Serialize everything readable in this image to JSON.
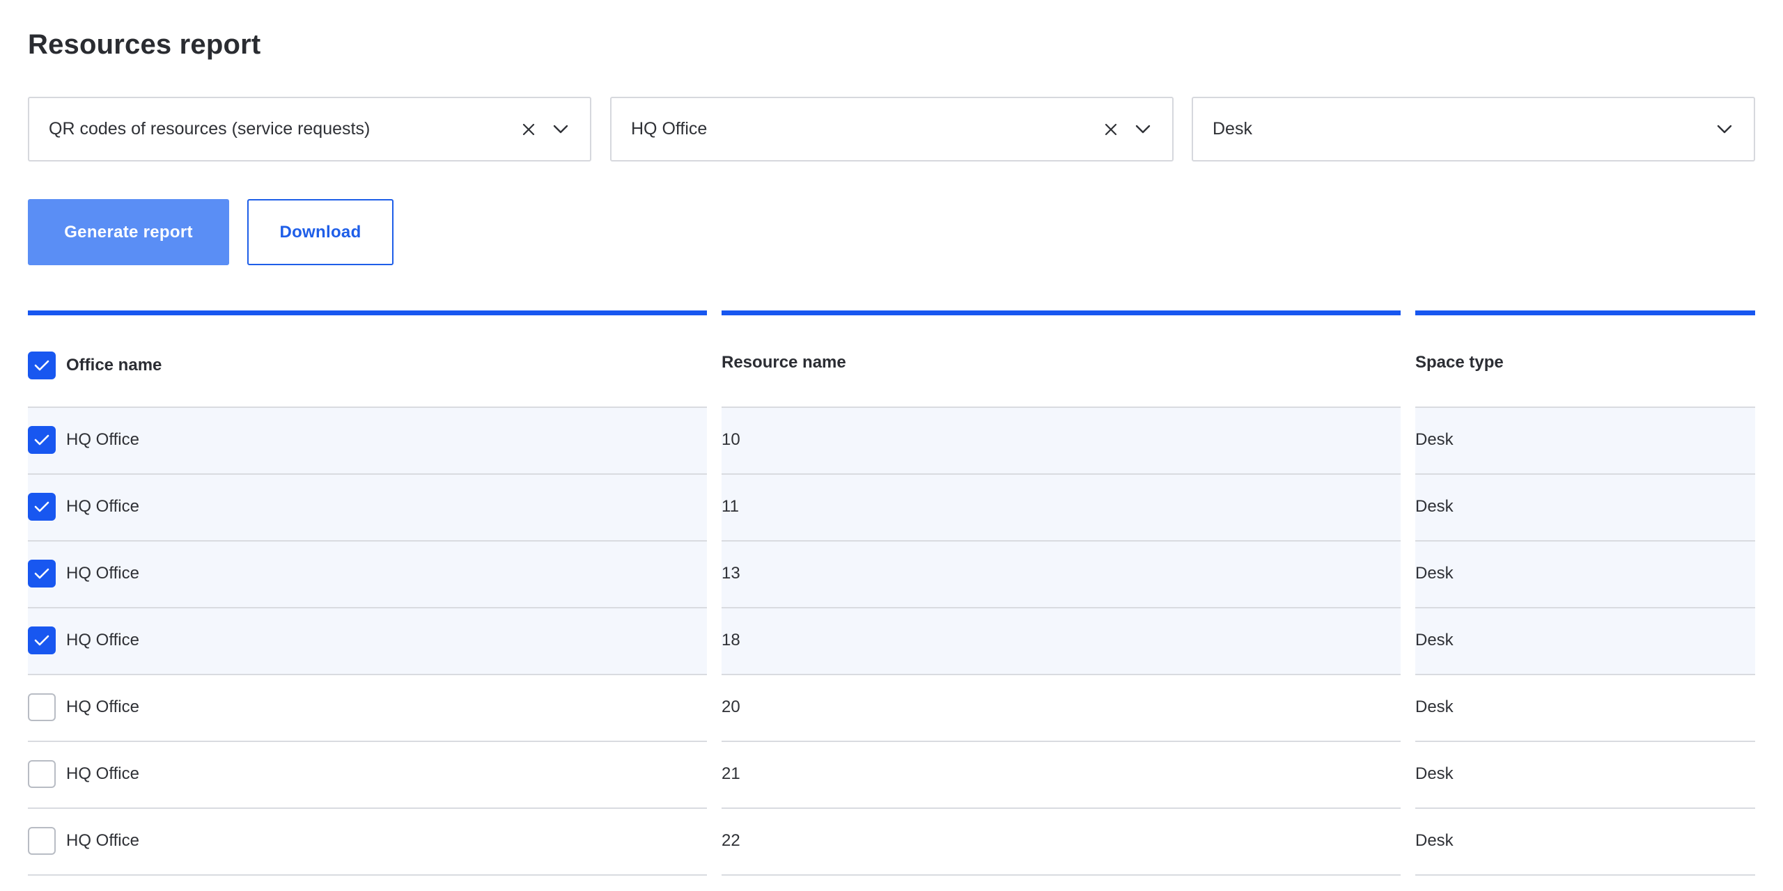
{
  "page": {
    "title": "Resources report"
  },
  "filters": [
    {
      "value": "QR codes of resources (service requests)",
      "clearable": true
    },
    {
      "value": "HQ Office",
      "clearable": true
    },
    {
      "value": "Desk",
      "clearable": false
    }
  ],
  "actions": {
    "generate_label": "Generate report",
    "download_label": "Download"
  },
  "table": {
    "columns": [
      "Office name",
      "Resource name",
      "Space type"
    ],
    "header_checked": true,
    "rows": [
      {
        "office": "HQ Office",
        "resource": "10",
        "space": "Desk",
        "checked": true
      },
      {
        "office": "HQ Office",
        "resource": "11",
        "space": "Desk",
        "checked": true
      },
      {
        "office": "HQ Office",
        "resource": "13",
        "space": "Desk",
        "checked": true
      },
      {
        "office": "HQ Office",
        "resource": "18",
        "space": "Desk",
        "checked": true
      },
      {
        "office": "HQ Office",
        "resource": "20",
        "space": "Desk",
        "checked": false
      },
      {
        "office": "HQ Office",
        "resource": "21",
        "space": "Desk",
        "checked": false
      },
      {
        "office": "HQ Office",
        "resource": "22",
        "space": "Desk",
        "checked": false
      }
    ]
  },
  "colors": {
    "accent": "#1857f0",
    "primary_button": "#5a8ef5",
    "row_selected": "#f4f7fd",
    "border": "#d6d8dd"
  },
  "icons": {
    "clear": "close-icon",
    "dropdown": "chevron-down-icon",
    "check": "checkmark-icon"
  }
}
